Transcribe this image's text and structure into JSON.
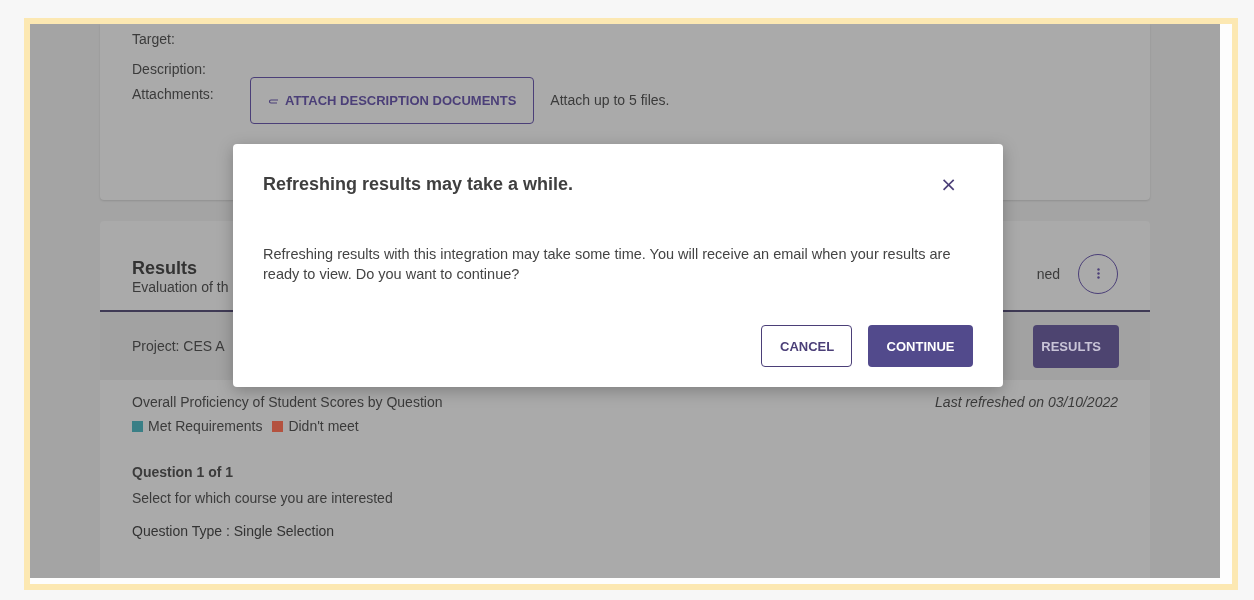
{
  "details": {
    "fields": [
      {
        "label": "Target:"
      },
      {
        "label": "Description:"
      },
      {
        "label": "Attachments:"
      }
    ],
    "attach_button": "ATTACH DESCRIPTION DOCUMENTS",
    "attach_hint": "Attach up to 5 files."
  },
  "results": {
    "title": "Results",
    "subtitle": "Evaluation of th",
    "status": "ned",
    "project": "Project: CES A",
    "refresh_button": "RESULTS",
    "chart_title": "Overall Proficiency of Student Scores by Question",
    "last_refreshed": "Last refreshed on 03/10/2022",
    "legend": [
      {
        "label": "Met Requirements",
        "color": "#3a7f86"
      },
      {
        "label": "Didn't meet",
        "color": "#b4523f"
      }
    ],
    "question_number": "Question 1 of 1",
    "question_text": "Select for which course you are interested",
    "question_type": "Question Type : Single Selection"
  },
  "dialog": {
    "title": "Refreshing results may take a while.",
    "close": "×",
    "message": "Refreshing results with this integration may take some time. You will receive an email when your results are ready to view. Do you want to continue?",
    "buttons": [
      {
        "label": "CANCEL",
        "kind": "outline"
      },
      {
        "label": "CONTINUE",
        "kind": "primary"
      }
    ]
  }
}
